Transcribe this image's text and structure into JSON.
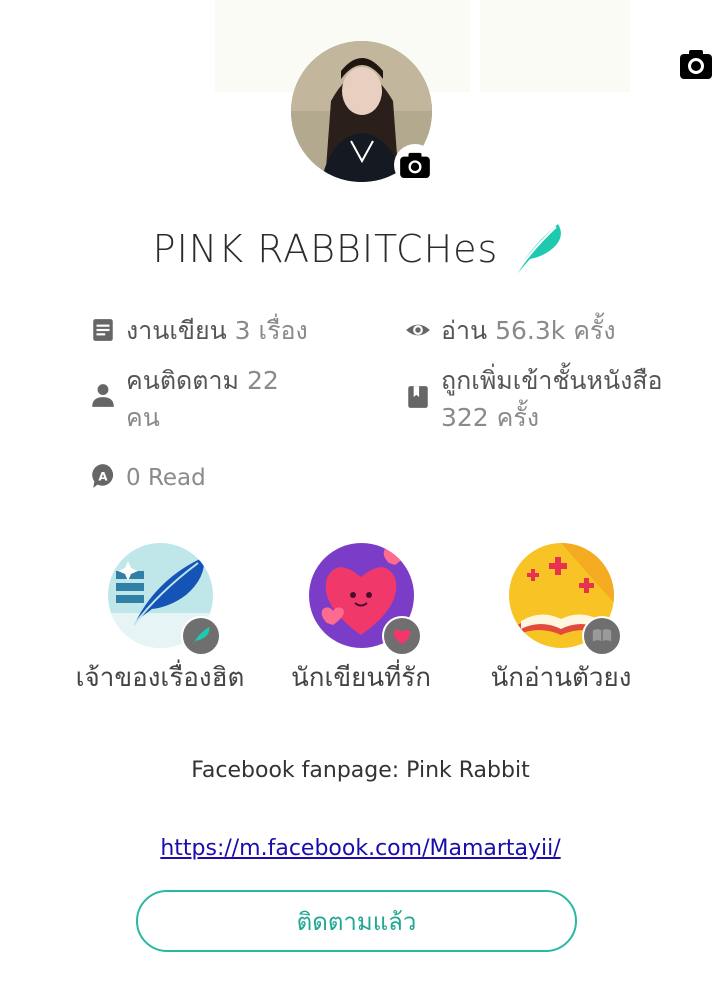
{
  "profile": {
    "name": "PINK RABBITCHes",
    "avatar_icon": "profile-photo",
    "badge_icon": "feather-icon",
    "accent_color": "#1ec9b0"
  },
  "stats": {
    "works": {
      "label": "งานเขียน",
      "value": "3 เรื่อง"
    },
    "reads": {
      "label": "อ่าน",
      "value": "56.3k ครั้ง"
    },
    "followers": {
      "label": "คนติดตาม",
      "value": "22 คน"
    },
    "bookshelf": {
      "label": "ถูกเพิ่มเข้าชั้นหนังสือ",
      "value": "322 ครั้ง"
    },
    "read_count": {
      "value": "0 Read"
    }
  },
  "badges": [
    {
      "label": "เจ้าของเรื่องฮิต",
      "icon": "feather-icon"
    },
    {
      "label": "นักเขียนที่รัก",
      "icon": "heart-icon"
    },
    {
      "label": "นักอ่านตัวยง",
      "icon": "book-icon"
    }
  ],
  "bio": {
    "text": "Facebook fanpage: Pink Rabbit",
    "link": "https://m.facebook.com/Mamartayii/"
  },
  "follow_button": {
    "label": "ติดตามแล้ว"
  }
}
